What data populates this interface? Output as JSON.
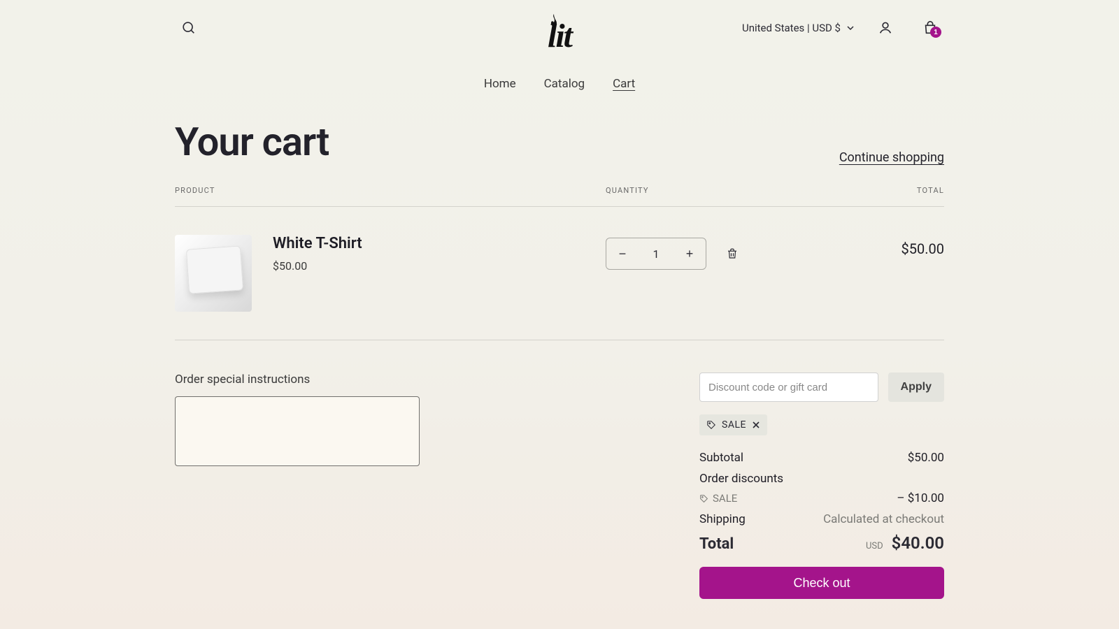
{
  "header": {
    "region_label": "United States | USD $",
    "cart_count": "1"
  },
  "logo_text": "lit",
  "nav": {
    "home": "Home",
    "catalog": "Catalog",
    "cart": "Cart"
  },
  "page": {
    "title": "Your cart",
    "continue": "Continue shopping"
  },
  "columns": {
    "product": "PRODUCT",
    "quantity": "QUANTITY",
    "total": "TOTAL"
  },
  "item": {
    "name": "White T-Shirt",
    "unit_price": "$50.00",
    "quantity": "1",
    "line_total": "$50.00"
  },
  "instructions": {
    "label": "Order special instructions",
    "value": ""
  },
  "discount": {
    "placeholder": "Discount code or gift card",
    "apply": "Apply",
    "applied_code": "SALE",
    "amount": "– $10.00"
  },
  "summary": {
    "subtotal_label": "Subtotal",
    "subtotal_value": "$50.00",
    "order_discounts_label": "Order discounts",
    "shipping_label": "Shipping",
    "shipping_value": "Calculated at checkout",
    "total_label": "Total",
    "currency": "USD",
    "total_value": "$40.00",
    "checkout": "Check out"
  }
}
